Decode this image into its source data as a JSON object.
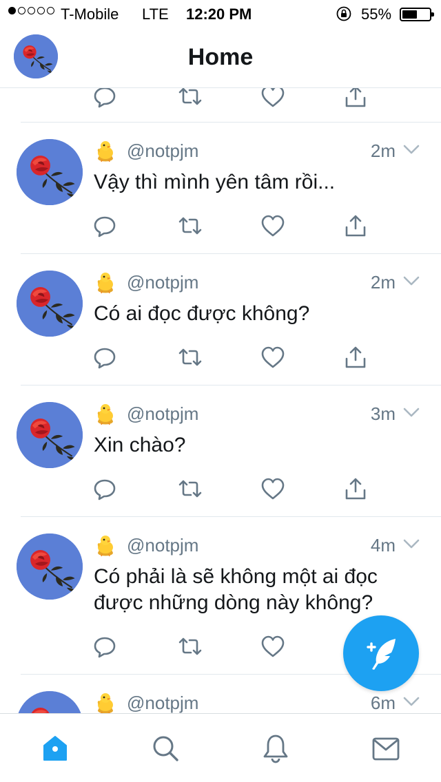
{
  "status_bar": {
    "carrier": "T-Mobile",
    "network": "LTE",
    "time": "12:20 PM",
    "battery": "55%",
    "battery_level": 0.55,
    "signal_bars_filled": 1,
    "signal_bars_total": 5
  },
  "header": {
    "title": "Home"
  },
  "tweets": [
    {
      "handle": "@notpjm",
      "time": "2m",
      "text": "Vậy thì mình yên tâm rồi..."
    },
    {
      "handle": "@notpjm",
      "time": "2m",
      "text": "Có ai đọc được không?"
    },
    {
      "handle": "@notpjm",
      "time": "3m",
      "text": "Xin chào?"
    },
    {
      "handle": "@notpjm",
      "time": "4m",
      "text": "Có phải là sẽ không một ai đọc được những dòng này không?"
    },
    {
      "handle": "@notpjm",
      "time": "6m",
      "text": ""
    }
  ],
  "icons": {
    "name_emoji": "baby-chick-icon",
    "reply": "reply-icon",
    "retweet": "retweet-icon",
    "like": "heart-icon",
    "share": "share-icon",
    "compose": "compose-tweet-icon"
  },
  "tabs": [
    {
      "name": "home",
      "icon": "home-icon",
      "active": true
    },
    {
      "name": "search",
      "icon": "search-icon",
      "active": false
    },
    {
      "name": "notifications",
      "icon": "bell-icon",
      "active": false
    },
    {
      "name": "messages",
      "icon": "envelope-icon",
      "active": false
    }
  ],
  "colors": {
    "accent": "#1da1f2",
    "secondary_text": "#657786",
    "icon_gray": "#657786",
    "avatar_bg": "#5b7fd6",
    "rose": "#d9262a"
  }
}
